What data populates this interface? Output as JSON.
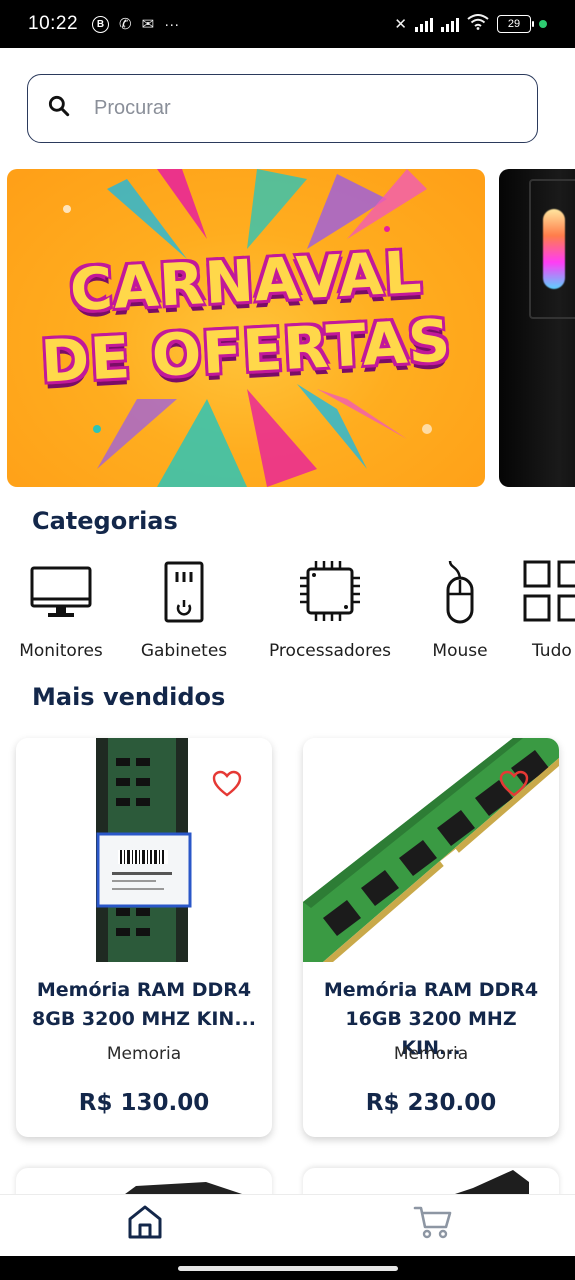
{
  "status_bar": {
    "time": "10:22",
    "battery": "29",
    "icons": [
      "b-circle-icon",
      "missed-call-icon",
      "message-icon",
      "more-dots-icon",
      "vibrate-off-icon",
      "signal-icon",
      "signal-icon",
      "wifi-icon",
      "battery-icon",
      "notification-dot-icon"
    ]
  },
  "search": {
    "placeholder": "Procurar",
    "icon": "search-icon"
  },
  "banners": [
    {
      "line1": "CARNAVAL",
      "line2": "DE OFERTAS"
    }
  ],
  "categories": {
    "title": "Categorias",
    "items": [
      {
        "label": "Monitores",
        "icon": "monitor-icon"
      },
      {
        "label": "Gabinetes",
        "icon": "pc-case-icon"
      },
      {
        "label": "Processadores",
        "icon": "cpu-icon"
      },
      {
        "label": "Mouse",
        "icon": "mouse-icon"
      },
      {
        "label": "Tudo",
        "icon": "grid-icon"
      }
    ]
  },
  "best_sellers": {
    "title": "Mais vendidos",
    "products": [
      {
        "title": "Memória RAM DDR4 8GB 3200 MHZ KIN...",
        "category": "Memoria",
        "price": "R$ 130.00"
      },
      {
        "title": "Memória RAM DDR4 16GB 3200 MHZ KIN...",
        "category": "Memoria",
        "price": "R$ 230.00"
      }
    ]
  },
  "bottom_nav": {
    "items": [
      {
        "icon": "home-icon",
        "active": true
      },
      {
        "icon": "cart-icon",
        "active": false
      }
    ]
  },
  "colors": {
    "primary": "#13274a",
    "favorite": "#e53935",
    "banner_orange": "#ffad1f"
  }
}
